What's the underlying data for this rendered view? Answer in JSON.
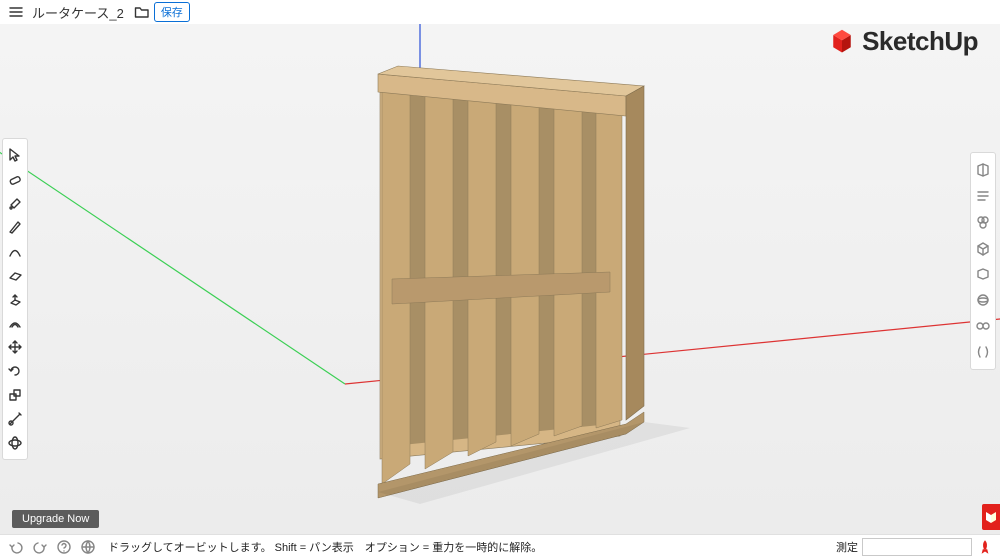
{
  "header": {
    "file_title": "ルータケース_2",
    "save_label": "保存"
  },
  "brand": {
    "name": "SketchUp"
  },
  "left_tools": [
    {
      "name": "select-tool",
      "icon": "cursor"
    },
    {
      "name": "eraser-tool",
      "icon": "eraser"
    },
    {
      "name": "paint-tool",
      "icon": "paint"
    },
    {
      "name": "pencil-tool",
      "icon": "pencil"
    },
    {
      "name": "arc-tool",
      "icon": "arc"
    },
    {
      "name": "rectangle-tool",
      "icon": "rect"
    },
    {
      "name": "pushpull-tool",
      "icon": "pushpull"
    },
    {
      "name": "offset-tool",
      "icon": "offset"
    },
    {
      "name": "move-tool",
      "icon": "move"
    },
    {
      "name": "rotate-tool",
      "icon": "rotate"
    },
    {
      "name": "scale-tool",
      "icon": "scale"
    },
    {
      "name": "tape-tool",
      "icon": "tape"
    },
    {
      "name": "orbit-tool",
      "icon": "text"
    }
  ],
  "right_panels": [
    {
      "name": "entity-info-panel",
      "icon": "info"
    },
    {
      "name": "instructor-panel",
      "icon": "panel"
    },
    {
      "name": "components-panel",
      "icon": "hex3"
    },
    {
      "name": "warehouse-panel",
      "icon": "cube"
    },
    {
      "name": "materials-panel",
      "icon": "box"
    },
    {
      "name": "styles-panel",
      "icon": "orbit"
    },
    {
      "name": "layers-panel",
      "icon": "eye"
    },
    {
      "name": "scenes-panel",
      "icon": "shape"
    }
  ],
  "upgrade": {
    "label": "Upgrade Now"
  },
  "status": {
    "hint": "ドラッグしてオービットします。 Shift = パン表示　オプション = 重力を一時的に解除。",
    "measure_label": "測定",
    "measure_value": ""
  }
}
